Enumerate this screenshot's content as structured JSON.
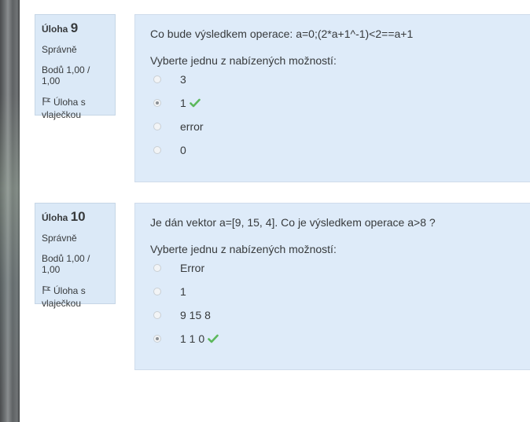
{
  "questions": [
    {
      "label": "Úloha",
      "number": "9",
      "state": "Správně",
      "grade": "Bodů 1,00 / 1,00",
      "flag_text": "Úloha s vlaječkou",
      "text": "Co bude výsledkem operace: a=0;(2*a+1^-1)<2==a+1",
      "prompt": "Vyberte jednu z nabízených možností:",
      "answers": [
        {
          "label": "3",
          "selected": false,
          "correct_mark": false
        },
        {
          "label": "1",
          "selected": true,
          "correct_mark": true
        },
        {
          "label": "error",
          "selected": false,
          "correct_mark": false
        },
        {
          "label": "0",
          "selected": false,
          "correct_mark": false
        }
      ]
    },
    {
      "label": "Úloha",
      "number": "10",
      "state": "Správně",
      "grade": "Bodů 1,00 / 1,00",
      "flag_text": "Úloha s vlaječkou",
      "text": "Je dán vektor a=[9, 15, 4].  Co je výsledkem operace a>8 ?",
      "prompt": "Vyberte jednu z nabízených možností:",
      "answers": [
        {
          "label": "Error",
          "selected": false,
          "correct_mark": false
        },
        {
          "label": "1",
          "selected": false,
          "correct_mark": false
        },
        {
          "label": "9 15 8",
          "selected": false,
          "correct_mark": false
        },
        {
          "label": "1 1 0",
          "selected": true,
          "correct_mark": true
        }
      ]
    }
  ],
  "colors": {
    "correct_check": "#5cb85c",
    "panel_background": "#deebf9"
  },
  "icons": {
    "flag": "flag-icon",
    "check": "check-icon"
  }
}
